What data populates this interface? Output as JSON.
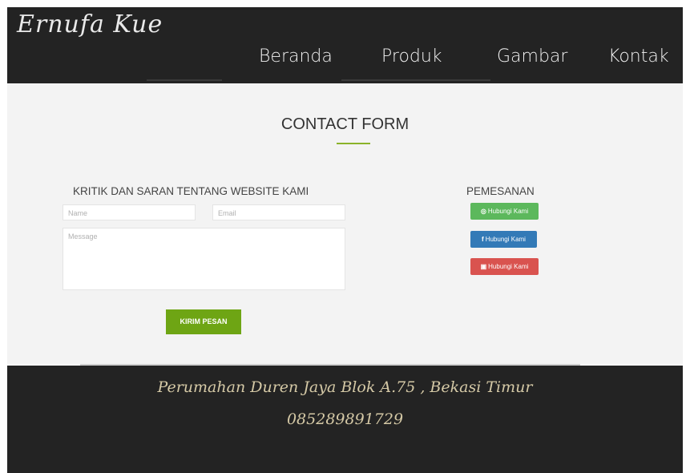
{
  "brand": "Ernufa Kue",
  "nav": {
    "items": [
      "Beranda",
      "Produk",
      "Gambar",
      "Kontak"
    ]
  },
  "section_title": "CONTACT FORM",
  "form": {
    "title": "KRITIK DAN SARAN TENTANG WEBSITE KAMI",
    "name_placeholder": "Name",
    "email_placeholder": "Email",
    "message_placeholder": "Message",
    "submit_label": "KIRIM PESAN"
  },
  "order": {
    "title": "PEMESANAN",
    "buttons": [
      {
        "label": "Hubungi Kami",
        "icon": "whatsapp-icon",
        "glyph": "◎",
        "color": "#5cb85c"
      },
      {
        "label": "Hubungi Kami",
        "icon": "facebook-icon",
        "glyph": "f",
        "color": "#337ab7"
      },
      {
        "label": "Hubungi Kami",
        "icon": "instagram-icon",
        "glyph": "▣",
        "color": "#d9534f"
      }
    ]
  },
  "footer": {
    "address": "Perumahan Duren Jaya Blok A.75 , Bekasi Timur",
    "phone": "085289891729"
  },
  "colors": {
    "header_bg": "#232323",
    "accent_green": "#6ea514",
    "footer_text": "#d5c9a6"
  }
}
